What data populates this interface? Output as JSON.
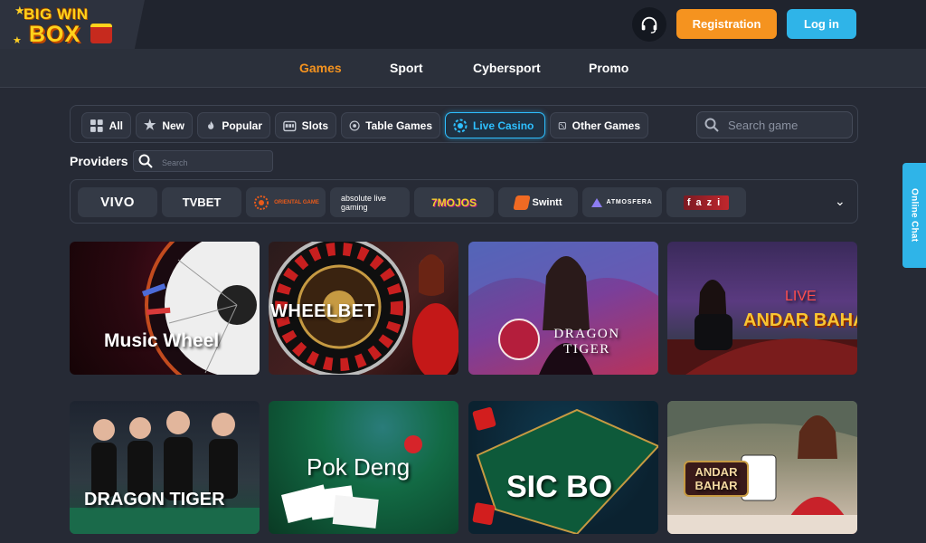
{
  "header": {
    "logo_top": "BIG WIN",
    "logo_bottom": "BOX",
    "registration_label": "Registration",
    "login_label": "Log in"
  },
  "nav": {
    "items": [
      {
        "label": "Games",
        "active": true
      },
      {
        "label": "Sport",
        "active": false
      },
      {
        "label": "Cybersport",
        "active": false
      },
      {
        "label": "Promo",
        "active": false
      }
    ]
  },
  "categories": [
    {
      "label": "All",
      "icon": "grid-icon"
    },
    {
      "label": "New",
      "icon": "star-icon"
    },
    {
      "label": "Popular",
      "icon": "flame-icon"
    },
    {
      "label": "Slots",
      "icon": "slot-machine-icon"
    },
    {
      "label": "Table Games",
      "icon": "roulette-icon"
    },
    {
      "label": "Live Casino",
      "icon": "live-chip-icon",
      "active": true
    },
    {
      "label": "Other Games",
      "icon": "dice-icon"
    }
  ],
  "search_game": {
    "placeholder": "Search game"
  },
  "providers": {
    "label": "Providers",
    "search_placeholder": "Search",
    "items": [
      "VIVO",
      "TVBET",
      "ORIENTAL GAME",
      "absolute live gaming",
      "7MOJOS",
      "Swintt",
      "ATMOSFERA",
      "fazi"
    ]
  },
  "online_chat_label": "Online Chat",
  "games": [
    {
      "title": "Music Wheel"
    },
    {
      "title": "WHEELBET"
    },
    {
      "title": "DRAGON TIGER"
    },
    {
      "title": "ANDAR BAHAR",
      "badge": "LIVE"
    },
    {
      "title": "DRAGON TIGER"
    },
    {
      "title": "Pok Deng"
    },
    {
      "title": "SIC BO"
    },
    {
      "title": "ANDAR BAHAR"
    }
  ],
  "colors": {
    "accent_orange": "#f5931f",
    "accent_blue": "#2fb4e8",
    "active_cat": "#2ec0ff",
    "bg": "#262a35"
  }
}
